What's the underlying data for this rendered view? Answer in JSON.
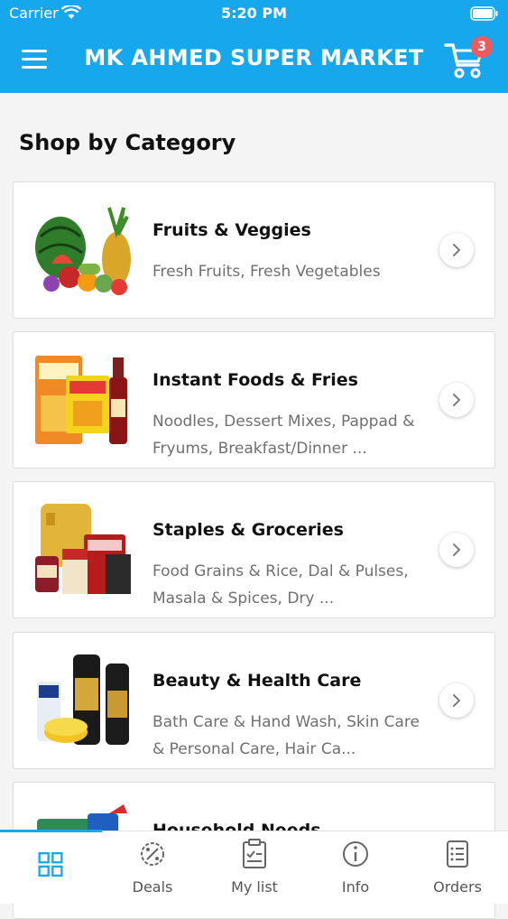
{
  "status_bar": {
    "carrier": "Carrier",
    "time": "5:20 PM"
  },
  "header": {
    "title": "MK AHMED SUPER MARKET",
    "cart_count": "3"
  },
  "section_title": "Shop by Category",
  "categories": [
    {
      "name": "Fruits & Veggies",
      "desc": "Fresh Fruits, Fresh Vegetables",
      "icon": "fruits-veggies-image"
    },
    {
      "name": "Instant Foods & Fries",
      "desc": "Noodles, Dessert Mixes, Pappad & Fryums, Breakfast/Dinner ...",
      "icon": "instant-foods-image"
    },
    {
      "name": "Staples & Groceries",
      "desc": "Food Grains & Rice, Dal & Pulses, Masala & Spices,  Dry ...",
      "icon": "staples-image"
    },
    {
      "name": "Beauty & Health Care",
      "desc": "Bath Care & Hand Wash, Skin Care & Personal Care, Hair Ca...",
      "icon": "beauty-image"
    },
    {
      "name": "Household Needs",
      "desc": "",
      "icon": "household-image"
    }
  ],
  "tabs": [
    {
      "label": "",
      "icon": "grid-icon"
    },
    {
      "label": "Deals",
      "icon": "deals-icon"
    },
    {
      "label": "My list",
      "icon": "clipboard-icon"
    },
    {
      "label": "Info",
      "icon": "info-icon"
    },
    {
      "label": "Orders",
      "icon": "orders-icon"
    }
  ],
  "colors": {
    "primary": "#16a7ec",
    "badge": "#ef5a5f",
    "text_muted": "#6f6f6f"
  }
}
